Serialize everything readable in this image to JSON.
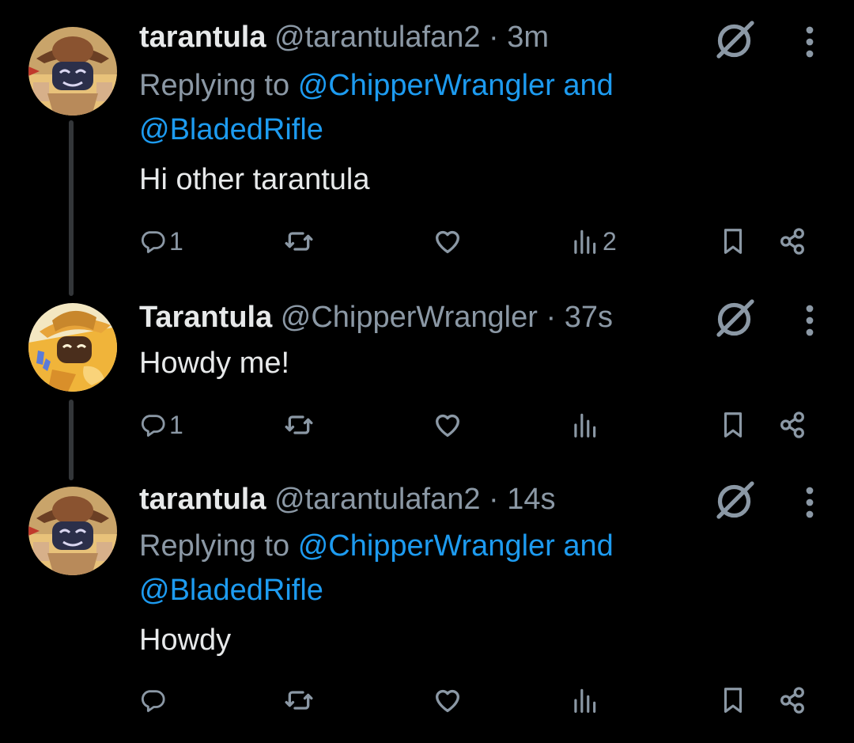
{
  "colors": {
    "background": "#000000",
    "text": "#e7e9ea",
    "muted": "#8b98a5",
    "accent": "#1d9bf0",
    "thread_line": "#333639"
  },
  "tweets": [
    {
      "name": "tarantula",
      "handle": "@tarantulafan2",
      "separator": "·",
      "time": "3m",
      "replying_prefix": "Replying to",
      "mention_1": "@ChipperWrangler",
      "mention_joiner": "and",
      "mention_2": "@BladedRifle",
      "text": "Hi other tarantula",
      "reply_count": "1",
      "retweet_count": "",
      "like_count": "",
      "view_count": "2",
      "avatar_icon": "avatar-hat-character"
    },
    {
      "name": "Tarantula",
      "handle": "@ChipperWrangler",
      "separator": "·",
      "time": "37s",
      "text": "Howdy me!",
      "reply_count": "1",
      "retweet_count": "",
      "like_count": "",
      "view_count": "",
      "avatar_icon": "avatar-cowboy-character"
    },
    {
      "name": "tarantula",
      "handle": "@tarantulafan2",
      "separator": "·",
      "time": "14s",
      "replying_prefix": "Replying to",
      "mention_1": "@ChipperWrangler",
      "mention_joiner": "and",
      "mention_2": "@BladedRifle",
      "text": "Howdy",
      "reply_count": "",
      "retweet_count": "",
      "like_count": "",
      "view_count": "",
      "avatar_icon": "avatar-hat-character"
    }
  ],
  "icons": [
    "reply-icon",
    "retweet-icon",
    "like-icon",
    "views-icon",
    "bookmark-icon",
    "share-icon",
    "grok-icon",
    "more-icon"
  ]
}
